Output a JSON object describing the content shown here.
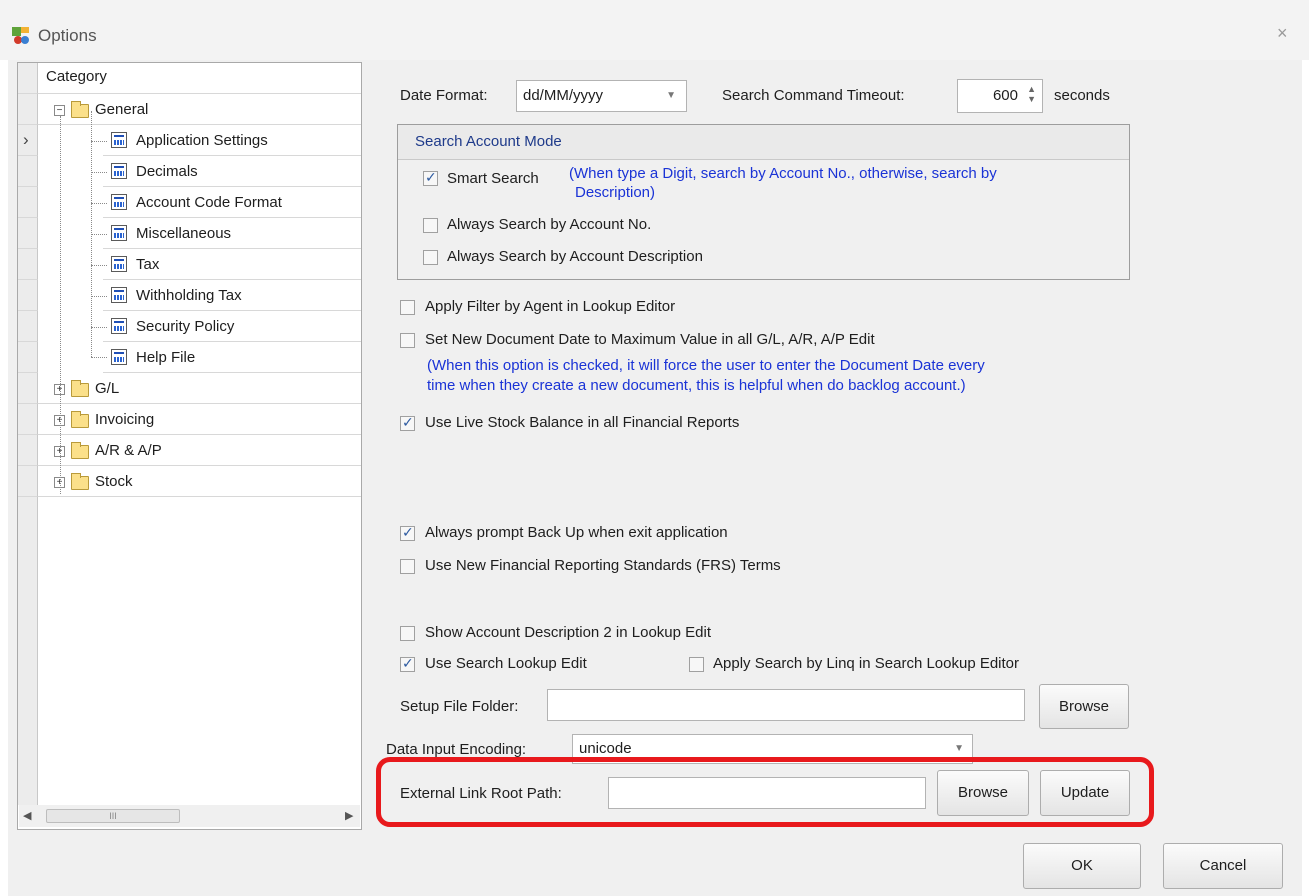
{
  "window": {
    "title": "Options",
    "close_glyph": "×",
    "icon": "app-options-icon"
  },
  "tree": {
    "header": "Category",
    "general": {
      "label": "General",
      "children": [
        "Application Settings",
        "Decimals",
        "Account Code Format",
        "Miscellaneous",
        "Tax",
        "Withholding Tax",
        "Security Policy",
        "Help File"
      ]
    },
    "others": [
      "G/L",
      "Invoicing",
      "A/R & A/P",
      "Stock"
    ],
    "current_row_glyph": "›",
    "scroll_left": "◀",
    "scroll_right": "▶",
    "thumb_grip": "III"
  },
  "date_format": {
    "label": "Date Format:",
    "value": "dd/MM/yyyy"
  },
  "search_timeout": {
    "label": "Search Command Timeout:",
    "value": "600",
    "unit": "seconds"
  },
  "search_mode": {
    "title": "Search Account Mode",
    "smart_search": {
      "label": "Smart Search",
      "checked": true
    },
    "smart_hint_line1": "(When type a Digit, search by Account No., otherwise, search by",
    "smart_hint_line2": "Description)",
    "by_account_no": {
      "label": "Always Search by Account No.",
      "checked": false
    },
    "by_description": {
      "label": "Always Search by Account Description",
      "checked": false
    }
  },
  "options": {
    "apply_filter_agent": {
      "label": "Apply Filter by Agent in Lookup Editor",
      "checked": false
    },
    "set_new_doc_date": {
      "label": "Set New Document Date to Maximum Value in all G/L, A/R, A/P Edit",
      "checked": false
    },
    "doc_date_hint_line1": "(When this option is checked, it will force the user to enter the Document Date every",
    "doc_date_hint_line2": "time when they create a new document, this is helpful when do backlog account.)",
    "live_stock": {
      "label": "Use Live Stock Balance in all Financial Reports",
      "checked": true
    },
    "prompt_backup": {
      "label": "Always prompt Back Up when exit application",
      "checked": true
    },
    "frs_terms": {
      "label": "Use New Financial Reporting Standards (FRS) Terms",
      "checked": false
    },
    "account_desc2": {
      "label": "Show Account Description 2 in Lookup Edit",
      "checked": false
    },
    "search_lookup": {
      "label": "Use Search Lookup Edit",
      "checked": true
    },
    "linq_search": {
      "label": "Apply Search by Linq in Search Lookup Editor",
      "checked": false
    }
  },
  "setup_folder": {
    "label": "Setup File Folder:",
    "value": "",
    "button": "Browse"
  },
  "encoding": {
    "label": "Data Input Encoding:",
    "value": "unicode"
  },
  "external_link": {
    "label": "External Link Root Path:",
    "value": "",
    "browse": "Browse",
    "update": "Update"
  },
  "footer": {
    "ok": "OK",
    "cancel": "Cancel"
  },
  "colors": {
    "highlight": "#e8191c",
    "hint_text": "#1a33d6"
  }
}
